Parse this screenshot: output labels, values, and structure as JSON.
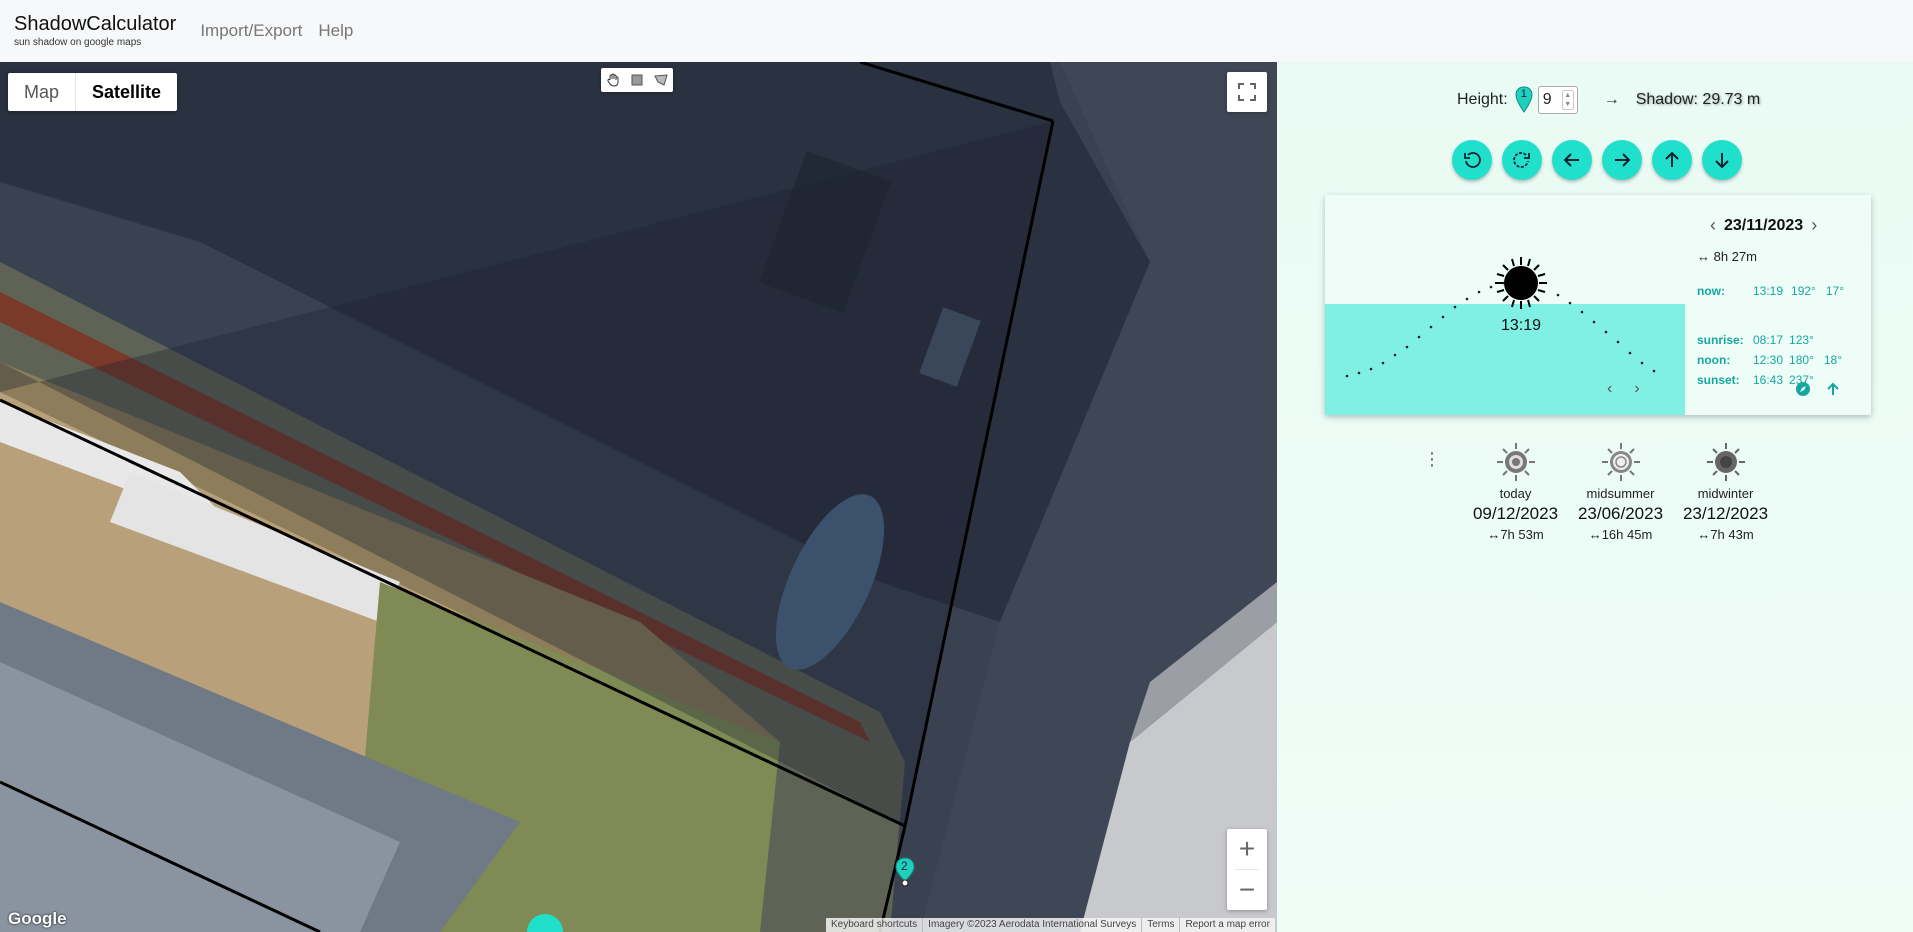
{
  "app": {
    "title": "ShadowCalculator",
    "subtitle": "sun shadow on google maps",
    "nav": [
      "Import/Export",
      "Help"
    ]
  },
  "map": {
    "type_buttons": [
      "Map",
      "Satellite"
    ],
    "selected_type": "Satellite",
    "google_logo": "Google",
    "attribution": [
      "Keyboard shortcuts",
      "Imagery ©2023 Aerodata International Surveys",
      "Terms",
      "Report a map error"
    ],
    "zoom_in": "+",
    "zoom_out": "−",
    "marker_label": "2"
  },
  "height": {
    "label": "Height:",
    "marker_label": "1",
    "value": "9",
    "arrow": "→",
    "shadow_text": "Shadow: 29.73 m"
  },
  "controls": [
    "rotate-left-icon",
    "rotate-right-icon",
    "arrow-left-icon",
    "arrow-right-icon",
    "arrow-up-icon",
    "arrow-down-icon"
  ],
  "sun": {
    "date": "23/11/2023",
    "prev": "‹",
    "next": "›",
    "day_length": "↔ 8h 27m",
    "current_time": "13:19",
    "now": {
      "label": "now:",
      "time": "13:19",
      "azimuth": "192°",
      "elevation": "17°"
    },
    "sunrise": {
      "label": "sunrise:",
      "time": "08:17",
      "azimuth": "123°"
    },
    "noon": {
      "label": "noon:",
      "time": "12:30",
      "azimuth": "180°",
      "elevation": "18°"
    },
    "sunset": {
      "label": "sunset:",
      "time": "16:43",
      "azimuth": "237°"
    },
    "colors": {
      "accent": "#20e0cc",
      "text_accent": "#18a6a0",
      "ground": "#7ff0e3"
    }
  },
  "presets": [
    {
      "label": "today",
      "date": "09/12/2023",
      "length": "↔7h 53m"
    },
    {
      "label": "midsummer",
      "date": "23/06/2023",
      "length": "↔16h 45m"
    },
    {
      "label": "midwinter",
      "date": "23/12/2023",
      "length": "↔7h 43m"
    }
  ]
}
